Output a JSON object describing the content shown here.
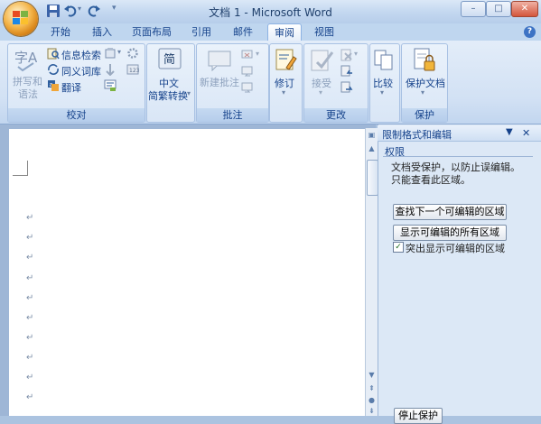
{
  "window": {
    "title": "文档 1 - Microsoft Word"
  },
  "tabs": [
    {
      "label": "开始"
    },
    {
      "label": "插入"
    },
    {
      "label": "页面布局"
    },
    {
      "label": "引用"
    },
    {
      "label": "邮件"
    },
    {
      "label": "审阅"
    },
    {
      "label": "视图"
    }
  ],
  "ribbon": {
    "proofing": {
      "group_label": "校对",
      "spelling_line1": "拼写和",
      "spelling_line2": "语法",
      "research": "信息检索",
      "thesaurus": "同义词库",
      "translate": "翻译"
    },
    "chinese": {
      "line1": "中文",
      "line2": "简繁转换"
    },
    "comments": {
      "group_label": "批注",
      "new_comment": "新建批注"
    },
    "tracking": {
      "track_changes": "修订"
    },
    "changes": {
      "group_label": "更改",
      "accept": "接受"
    },
    "compare": {
      "compare": "比较"
    },
    "protect": {
      "group_label": "保护",
      "protect_document": "保护文档"
    }
  },
  "task_pane": {
    "title": "限制格式和编辑",
    "section": "权限",
    "info_line1": "文档受保护，以防止误编辑。",
    "info_line2": "只能查看此区域。",
    "find_next_button": "查找下一个可编辑的区域",
    "show_all_button": "显示可编辑的所有区域",
    "highlight_checkbox": "突出显示可编辑的区域",
    "highlight_checked": true,
    "stop_protection_button": "停止保护"
  },
  "colors": {
    "ribbon_text": "#15428b",
    "active_tab_bg": "#ffffff",
    "frame": "#abc3e0"
  }
}
